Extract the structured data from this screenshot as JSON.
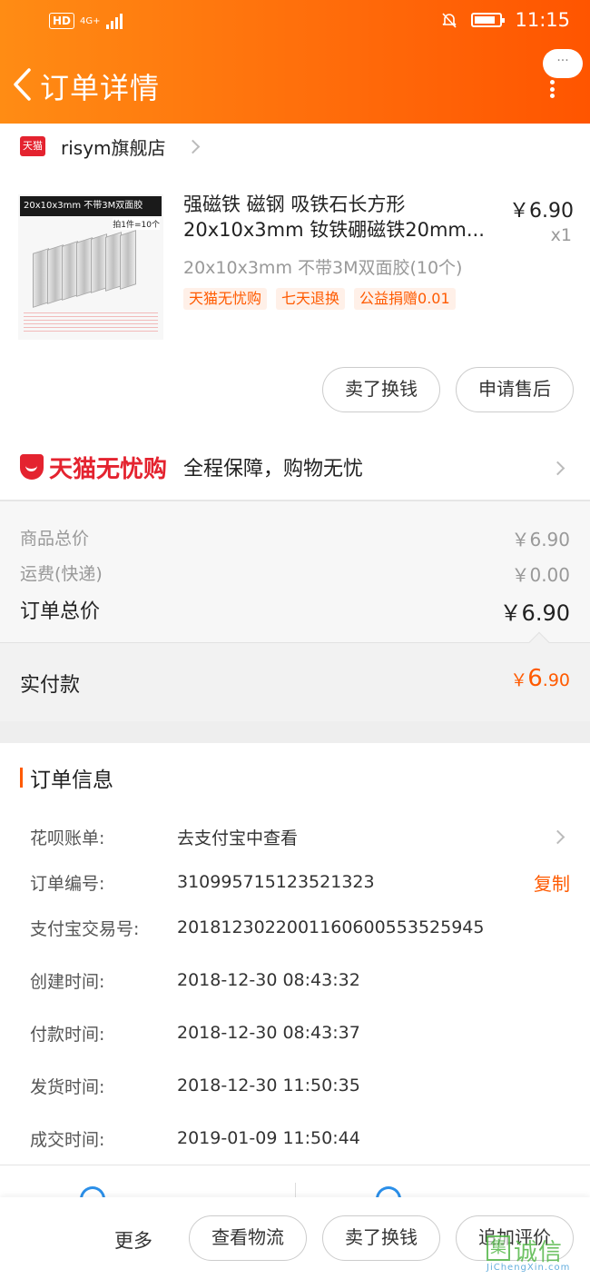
{
  "status_bar": {
    "network": "HD",
    "signal_type": "4G+",
    "time": "11:15"
  },
  "header": {
    "title": "订单详情",
    "more_bubble": "···"
  },
  "shop": {
    "badge": "天猫",
    "name": "risym旗舰店"
  },
  "product": {
    "image_label": "20x10x3mm  不带3M双面胶",
    "image_sublabel": "拍1件=10个",
    "title": "强磁铁 磁钢 吸铁石长方形 20x10x3mm 钕铁硼磁铁20mm...",
    "price": "￥6.90",
    "qty": "x1",
    "sku": "20x10x3mm 不带3M双面胶(10个)",
    "tags": [
      "天猫无忧购",
      "七天退换",
      "公益捐赠0.01"
    ],
    "buttons": {
      "sell": "卖了换钱",
      "after_sale": "申请售后"
    }
  },
  "guarantee": {
    "brand": "天猫无忧购",
    "slogan": "全程保障，购物无忧"
  },
  "summary": {
    "goods_label": "商品总价",
    "goods_value": "￥6.90",
    "shipping_label": "运费(快递)",
    "shipping_value": "￥0.00",
    "total_label": "订单总价",
    "total_value": "￥6.90",
    "paid_label": "实付款",
    "paid_currency": "￥",
    "paid_int": "6",
    "paid_dec": ".90"
  },
  "order_info": {
    "title": "订单信息",
    "rows": [
      {
        "label": "花呗账单:",
        "value": "去支付宝中查看"
      },
      {
        "label": "订单编号:",
        "value": "310995715123521323",
        "action": "复制"
      },
      {
        "label": "支付宝交易号:",
        "value": "2018123022001160600553525945"
      },
      {
        "label": "创建时间:",
        "value": "2018-12-30 08:43:32"
      },
      {
        "label": "付款时间:",
        "value": "2018-12-30 08:43:37"
      },
      {
        "label": "发货时间:",
        "value": "2018-12-30 11:50:35"
      },
      {
        "label": "成交时间:",
        "value": "2019-01-09 11:50:44"
      }
    ]
  },
  "bottom_bar": {
    "more": "更多",
    "logistics": "查看物流",
    "sell": "卖了换钱",
    "review": "追加评价"
  },
  "watermark": {
    "icon_char": "集",
    "cn": "诚信",
    "en": "JiChengXin.com"
  },
  "colors": {
    "header_start": "#ff8c14",
    "header_end": "#ff5500",
    "accent": "#ff5a00",
    "tmall_red": "#e4232f"
  }
}
